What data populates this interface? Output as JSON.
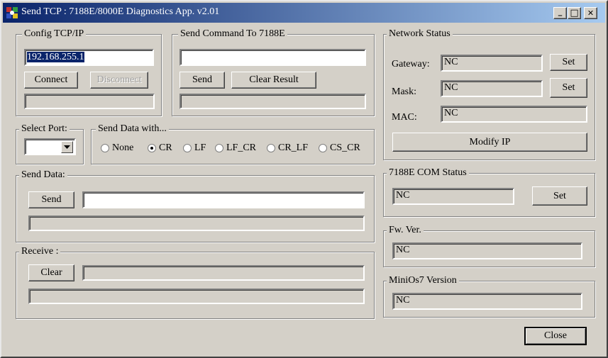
{
  "window": {
    "title": "Send TCP : 7188E/8000E Diagnostics App. v2.01",
    "controls": {
      "minimize": "_",
      "maximize": "□",
      "close": "✕"
    }
  },
  "config_tcpip": {
    "label": "Config TCP/IP",
    "ip_value": "192.168.255.1",
    "connect_label": "Connect",
    "disconnect_label": "Disconnect",
    "status_value": ""
  },
  "send_command": {
    "label": "Send Command To 7188E",
    "command_value": "",
    "send_label": "Send",
    "clear_result_label": "Clear Result",
    "result_value": ""
  },
  "select_port": {
    "label": "Select Port:",
    "selected": ""
  },
  "send_data_with": {
    "label": "Send Data with...",
    "options": [
      "None",
      "CR",
      "LF",
      "LF_CR",
      "CR_LF",
      "CS_CR"
    ],
    "selected": "CR"
  },
  "send_data": {
    "label": "Send Data:",
    "send_label": "Send",
    "data_value": "",
    "status_value": ""
  },
  "receive": {
    "label": "Receive :",
    "clear_label": "Clear",
    "received_value": "",
    "status_value": ""
  },
  "network_status": {
    "label": "Network Status",
    "gateway_label": "Gateway:",
    "gateway_value": "NC",
    "gateway_set_label": "Set",
    "mask_label": "Mask:",
    "mask_value": "NC",
    "mask_set_label": "Set",
    "mac_label": "MAC:",
    "mac_value": "NC",
    "modify_ip_label": "Modify IP"
  },
  "com_status": {
    "label": "7188E COM Status",
    "value": "NC",
    "set_label": "Set"
  },
  "fw_version": {
    "label": "Fw. Ver.",
    "value": "NC"
  },
  "minios_version": {
    "label": "MiniOs7 Version",
    "value": "NC"
  },
  "close_label": "Close"
}
